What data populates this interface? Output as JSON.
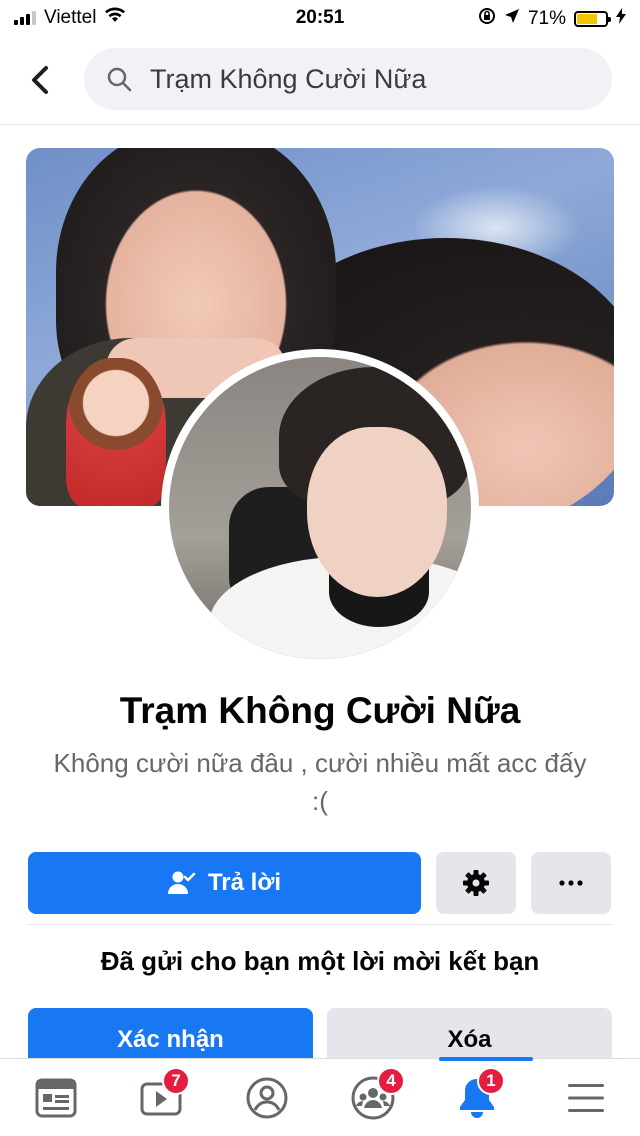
{
  "status_bar": {
    "carrier": "Viettel",
    "time": "20:51",
    "battery_percent": "71%",
    "battery_level": 0.71,
    "icons": [
      "signal-icon",
      "wifi-icon",
      "screen-lock-icon",
      "location-icon",
      "battery-icon",
      "charging-icon"
    ]
  },
  "header": {
    "search_text": "Trạm Không Cười Nữa"
  },
  "profile": {
    "name": "Trạm Không Cười Nữa",
    "bio": "Không cười nữa đâu , cười nhiều mất acc đấy :("
  },
  "actions": {
    "reply_label": "Trả lời",
    "request_text": "Đã gửi cho bạn một lời mời kết bạn",
    "confirm_label": "Xác nhận",
    "delete_label": "Xóa"
  },
  "bottom_nav": {
    "items": [
      {
        "icon": "news-feed-icon",
        "badge": ""
      },
      {
        "icon": "watch-icon",
        "badge": "7"
      },
      {
        "icon": "profile-icon",
        "badge": ""
      },
      {
        "icon": "groups-icon",
        "badge": "4"
      },
      {
        "icon": "notifications-icon",
        "badge": "1"
      },
      {
        "icon": "menu-icon",
        "badge": ""
      }
    ]
  },
  "colors": {
    "accent": "#1877f2",
    "badge": "#e41e3f",
    "secondary_button": "#e4e6eb",
    "battery": "#f5c400"
  }
}
